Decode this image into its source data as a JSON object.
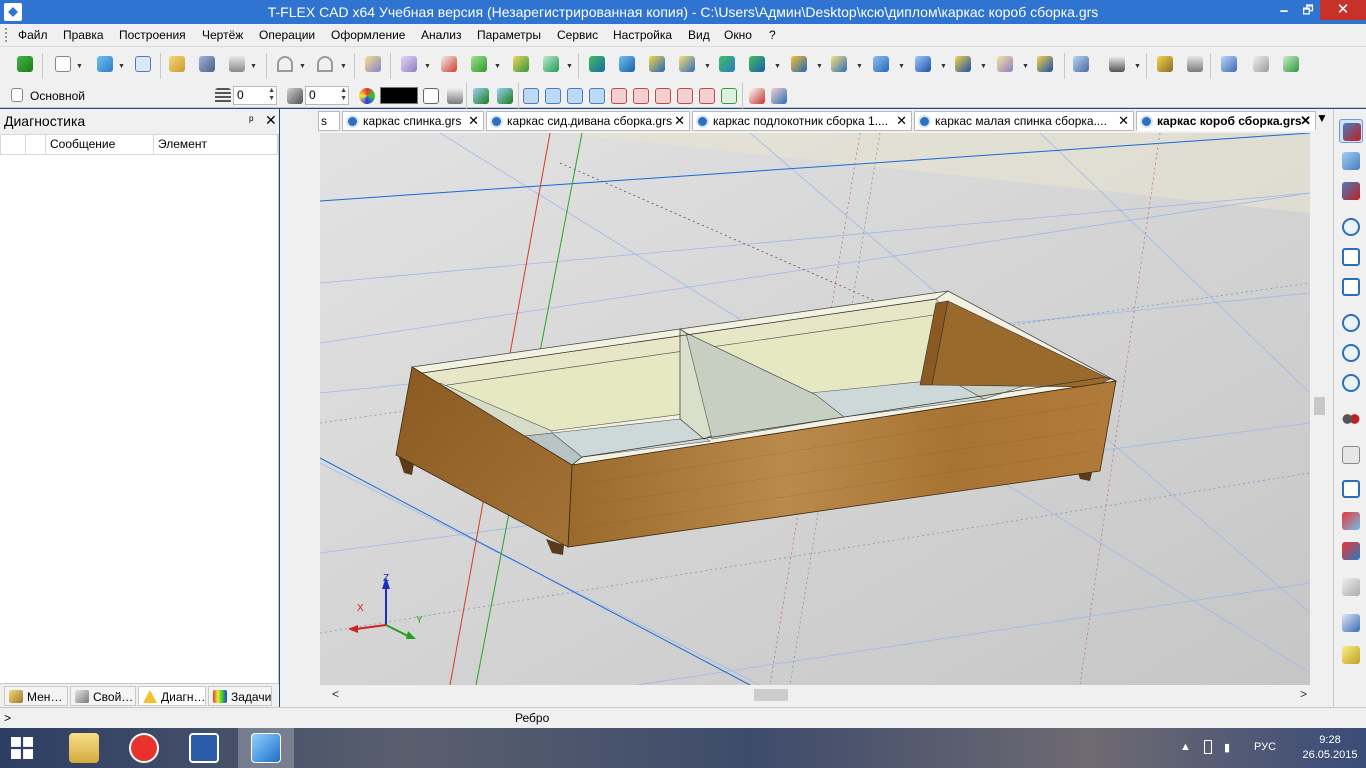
{
  "window": {
    "title": "T-FLEX CAD x64 Учебная версия (Незарегистрированная копия) - C:\\Users\\Админ\\Desktop\\ксю\\диплом\\каркас короб сборка.grs",
    "minimize": "🗕",
    "restore": "🗗",
    "close": "✕",
    "app_icon": "tflex-logo-icon"
  },
  "menu": [
    "Файл",
    "Правка",
    "Построения",
    "Чертёж",
    "Операции",
    "Оформление",
    "Анализ",
    "Параметры",
    "Сервис",
    "Настройка",
    "Вид",
    "Окно",
    "?"
  ],
  "toolbar2": {
    "style_label": "Основной",
    "line_width_value": "0",
    "layer_value": "0",
    "color_value": "#000000"
  },
  "left_panel": {
    "title": "Диагностика",
    "pin": "ᵖ",
    "close": "✕",
    "columns": [
      "",
      "Сообщение",
      "Элемент"
    ],
    "tabs": [
      {
        "label": "Мен…",
        "icon": "menu-tree-icon"
      },
      {
        "label": "Свой…",
        "icon": "properties-icon"
      },
      {
        "label": "Диагн…",
        "icon": "warning-icon"
      },
      {
        "label": "Задачи",
        "icon": "tasks-icon"
      }
    ]
  },
  "doc_tabs": [
    {
      "label": "s",
      "active": false
    },
    {
      "label": "каркас спинка.grs",
      "active": false
    },
    {
      "label": "каркас сид.дивана сборка.grs",
      "active": false
    },
    {
      "label": "каркас подлокотник сборка 1....",
      "active": false
    },
    {
      "label": "каркас малая спинка сборка....",
      "active": false
    },
    {
      "label": "каркас короб сборка.grs",
      "active": true
    }
  ],
  "tab_close": "✕",
  "tab_overflow": "▼",
  "viewport": {
    "axis_x": "X",
    "axis_y": "Y",
    "axis_z": "Z",
    "colors": {
      "background": "#d3d3d3",
      "wood": "#b07a3a",
      "panel_inner": "#e6e8c2",
      "floor": "#cdd8d8"
    }
  },
  "hscroll": {
    "left": "<",
    "right": ">"
  },
  "status": {
    "prompt": ">",
    "text": "Ребро"
  },
  "taskbar": {
    "apps": [
      "windows-start-icon",
      "file-explorer-icon",
      "yandex-browser-icon",
      "word-icon",
      "tflex-cad-icon"
    ],
    "tray_chevron": "▲",
    "lang": "РУС",
    "time": "9:28",
    "date": "26.05.2015"
  }
}
